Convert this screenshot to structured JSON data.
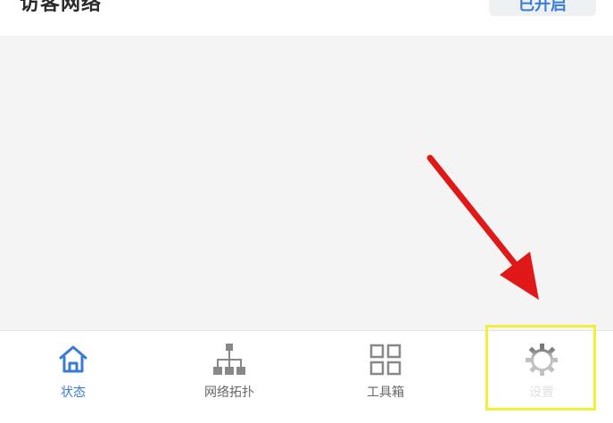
{
  "header": {
    "title": "访客网络",
    "action_label": "已开启"
  },
  "tabbar": {
    "tabs": [
      {
        "label": "状态",
        "icon": "home-icon",
        "active": true
      },
      {
        "label": "网络拓扑",
        "icon": "network-topology-icon",
        "active": false
      },
      {
        "label": "工具箱",
        "icon": "toolbox-grid-icon",
        "active": false
      },
      {
        "label": "设置",
        "icon": "gear-icon",
        "active": false
      }
    ]
  },
  "colors": {
    "accent": "#3a7bd5",
    "highlight": "#f0ef3a",
    "annotation_arrow": "#e01818",
    "content_background": "#f4f4f4"
  }
}
